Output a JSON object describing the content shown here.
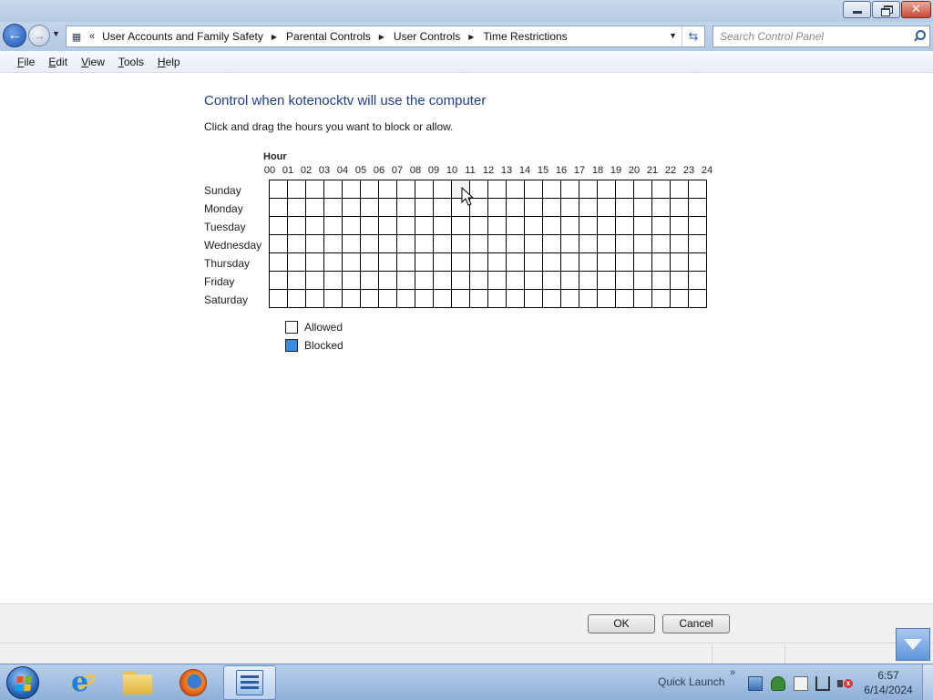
{
  "window": {
    "minimize_icon": "minimize-icon",
    "restore_icon": "restore-icon",
    "close_icon": "close-icon",
    "close_color": "#c74a35"
  },
  "navigation": {
    "back_icon": "back-arrow-icon",
    "forward_icon": "forward-arrow-icon",
    "recent_icon": "chevron-down-icon",
    "address_icon": "control-panel-icon",
    "overflow_chevron": "«",
    "breadcrumbs": [
      "User Accounts and Family Safety",
      "Parental Controls",
      "User Controls",
      "Time Restrictions"
    ],
    "search_placeholder": "Search Control Panel",
    "refresh_icon": "refresh-icon",
    "search_icon": "search-icon"
  },
  "menu": {
    "items": [
      {
        "label_u": "F",
        "label_rest": "ile"
      },
      {
        "label_u": "E",
        "label_rest": "dit"
      },
      {
        "label_u": "V",
        "label_rest": "iew"
      },
      {
        "label_u": "T",
        "label_rest": "ools"
      },
      {
        "label_u": "H",
        "label_rest": "elp"
      }
    ]
  },
  "main": {
    "title": "Control when kotenocktv will use the computer",
    "instruction": "Click and drag the hours you want to block or allow.",
    "hour_label": "Hour",
    "hours": [
      "00",
      "01",
      "02",
      "03",
      "04",
      "05",
      "06",
      "07",
      "08",
      "09",
      "10",
      "11",
      "12",
      "13",
      "14",
      "15",
      "16",
      "17",
      "18",
      "19",
      "20",
      "21",
      "22",
      "23",
      "24"
    ],
    "days": [
      "Sunday",
      "Monday",
      "Tuesday",
      "Wednesday",
      "Thursday",
      "Friday",
      "Saturday"
    ],
    "hovered_cell": {
      "day": "Sunday",
      "hour": "10"
    },
    "legend": {
      "allowed": "Allowed",
      "blocked": "Blocked",
      "allowed_color": "#ffffff",
      "blocked_color": "#3b8be0"
    }
  },
  "buttons": {
    "ok": "OK",
    "cancel": "Cancel"
  },
  "taskbar": {
    "start_icon": "windows-start-icon",
    "pinned": [
      "internet-explorer-icon",
      "file-explorer-icon",
      "firefox-icon",
      "control-panel-icon"
    ],
    "active_app": "control-panel-icon",
    "quick_launch": "Quick Launch",
    "tray": [
      "network-icon",
      "security-shield-icon",
      "document-icon",
      "connection-icon",
      "volume-muted-icon"
    ],
    "time": "6:57",
    "date": "6/14/2024"
  }
}
